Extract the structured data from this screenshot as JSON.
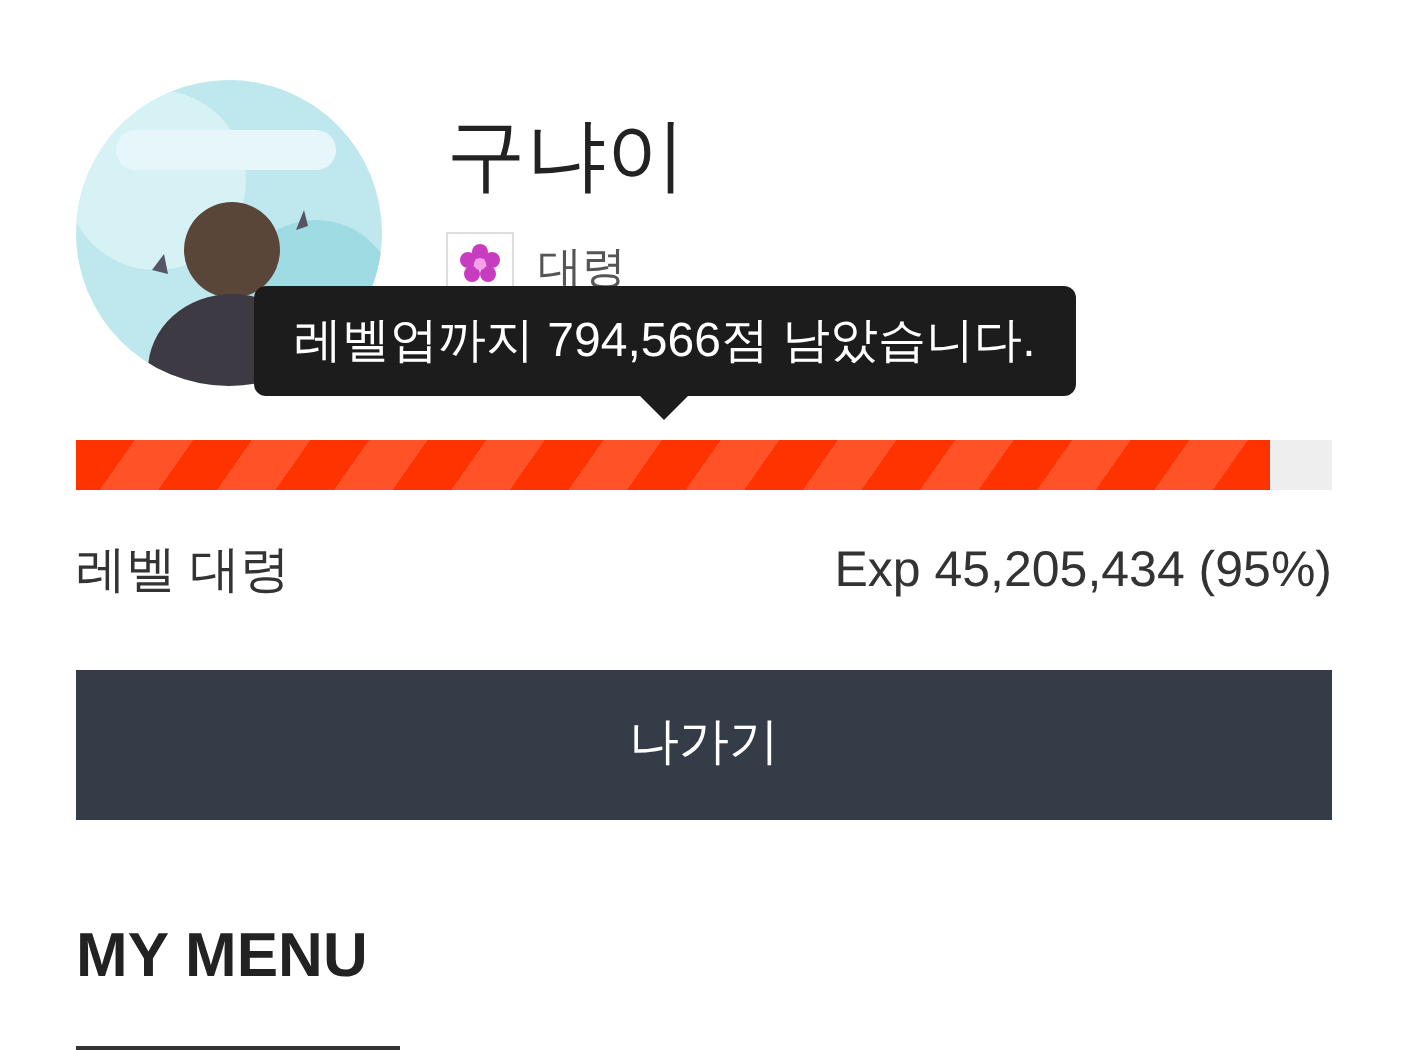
{
  "profile": {
    "nickname": "구냐이",
    "rank": "대령"
  },
  "tooltip": "레벨업까지 794,566점 남았습니다.",
  "exp_bar": {
    "level": 0.95
  },
  "level_label": "레벨 대령",
  "exp_label": "Exp 45,205,434 (95%)",
  "logout_button": "나가기",
  "section_title": "MY MENU"
}
